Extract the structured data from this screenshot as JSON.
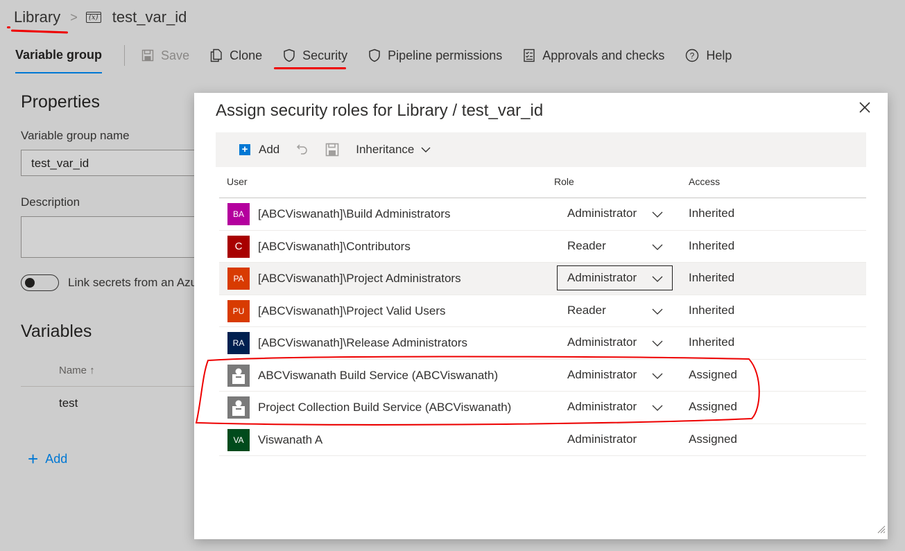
{
  "breadcrumb": {
    "library": "Library",
    "item": "test_var_id",
    "item_icon": "variable-group-icon"
  },
  "toolbar": {
    "active_tab": "Variable group",
    "save": "Save",
    "clone": "Clone",
    "security": "Security",
    "pipeline_permissions": "Pipeline permissions",
    "approvals": "Approvals and checks",
    "help": "Help"
  },
  "properties": {
    "title": "Properties",
    "name_label": "Variable group name",
    "name_value": "test_var_id",
    "description_label": "Description",
    "link_secrets_label": "Link secrets from an Azu"
  },
  "variables": {
    "title": "Variables",
    "name_col": "Name ↑",
    "items": [
      "test"
    ],
    "add_label": "Add"
  },
  "dialog": {
    "title": "Assign security roles for Library / test_var_id",
    "cmd": {
      "add": "Add",
      "inheritance": "Inheritance"
    },
    "columns": {
      "user": "User",
      "role": "Role",
      "access": "Access"
    },
    "rows": [
      {
        "initials": "BA",
        "color": "#b4009e",
        "user": "[ABCViswanath]\\Build Administrators",
        "role": "Administrator",
        "access": "Inherited",
        "dropdown": true
      },
      {
        "initials": "C",
        "color": "#a80000",
        "user": "[ABCViswanath]\\Contributors",
        "role": "Reader",
        "access": "Inherited",
        "dropdown": true
      },
      {
        "initials": "PA",
        "color": "#d83b01",
        "user": "[ABCViswanath]\\Project Administrators",
        "role": "Administrator",
        "access": "Inherited",
        "dropdown": true
      },
      {
        "initials": "PU",
        "color": "#d83b01",
        "user": "[ABCViswanath]\\Project Valid Users",
        "role": "Reader",
        "access": "Inherited",
        "dropdown": true
      },
      {
        "initials": "RA",
        "color": "#002050",
        "user": "[ABCViswanath]\\Release Administrators",
        "role": "Administrator",
        "access": "Inherited",
        "dropdown": true
      },
      {
        "initials": "",
        "color": "#7a7a7a",
        "user": "ABCViswanath Build Service (ABCViswanath)",
        "role": "Administrator",
        "access": "Assigned",
        "dropdown": true
      },
      {
        "initials": "",
        "color": "#7a7a7a",
        "user": "Project Collection Build Service (ABCViswanath)",
        "role": "Administrator",
        "access": "Assigned",
        "dropdown": true
      },
      {
        "initials": "VA",
        "color": "#004b1c",
        "user": "Viswanath A",
        "role": "Administrator",
        "access": "Assigned",
        "dropdown": false
      }
    ]
  },
  "colors": {
    "accent": "#0078d4",
    "annotation": "#e00000"
  }
}
